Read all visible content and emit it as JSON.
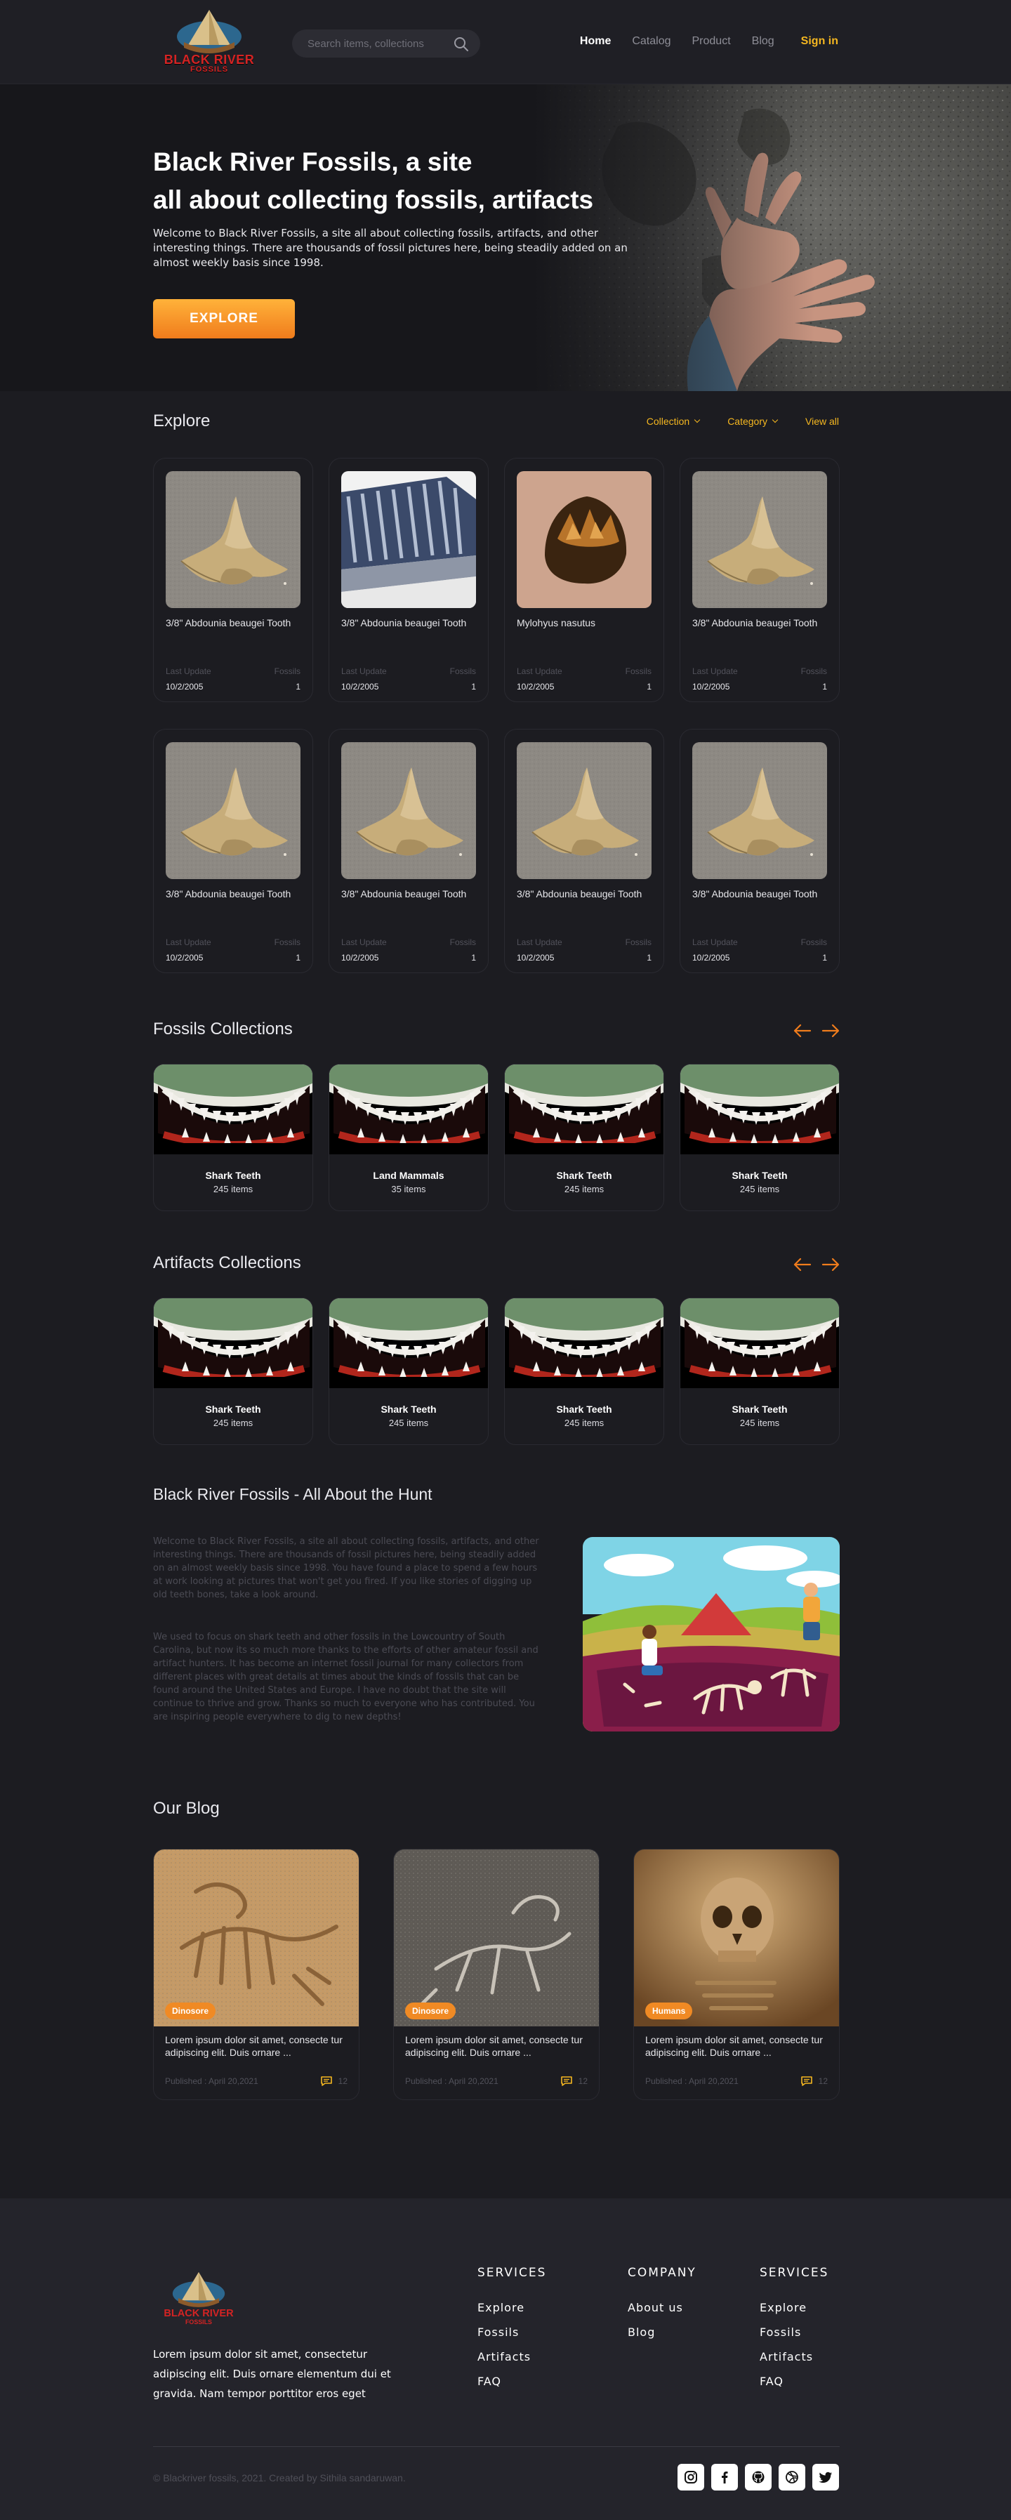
{
  "header": {
    "logo_line1": "BLACK RIVER",
    "logo_line2": "FOSSILS",
    "search_placeholder": "Search items, collections",
    "nav": [
      "Home",
      "Catalog",
      "Product",
      "Blog"
    ],
    "sign_in": "Sign in"
  },
  "hero": {
    "title_line1": "Black River Fossils, a site",
    "title_line2": "all about collecting fossils, artifacts",
    "subtitle": "Welcome to Black River Fossils, a site all about collecting fossils, artifacts, and other interesting things. There are thousands of fossil pictures here, being steadily added on an almost weekly basis since 1998.",
    "cta": "EXPLORE"
  },
  "explore": {
    "title": "Explore",
    "filters": {
      "collection": "Collection",
      "category": "Category",
      "view_all": "View all"
    },
    "last_update_label": "Last Update",
    "fossils_label": "Fossils",
    "items": [
      {
        "name": "3/8\" Abdounia beaugei Tooth",
        "date": "10/2/2005",
        "count": "1",
        "image": "shark-tooth"
      },
      {
        "name": "3/8\" Abdounia beaugei Tooth",
        "date": "10/2/2005",
        "count": "1",
        "image": "mammoth-tooth"
      },
      {
        "name": "Mylohyus nasutus",
        "date": "10/2/2005",
        "count": "1",
        "image": "peccary-tooth"
      },
      {
        "name": "3/8\" Abdounia beaugei Tooth",
        "date": "10/2/2005",
        "count": "1",
        "image": "shark-tooth"
      },
      {
        "name": "3/8\" Abdounia beaugei Tooth",
        "date": "10/2/2005",
        "count": "1",
        "image": "shark-tooth"
      },
      {
        "name": "3/8\" Abdounia beaugei Tooth",
        "date": "10/2/2005",
        "count": "1",
        "image": "shark-tooth"
      },
      {
        "name": "3/8\" Abdounia beaugei Tooth",
        "date": "10/2/2005",
        "count": "1",
        "image": "shark-tooth"
      },
      {
        "name": "3/8\" Abdounia beaugei Tooth",
        "date": "10/2/2005",
        "count": "1",
        "image": "shark-tooth"
      }
    ]
  },
  "fossils_collections": {
    "title": "Fossils Collections",
    "items": [
      {
        "name": "Shark Teeth",
        "count": "245 items"
      },
      {
        "name": "Land Mammals",
        "count": "35 items"
      },
      {
        "name": "Shark Teeth",
        "count": "245 items"
      },
      {
        "name": "Shark Teeth",
        "count": "245 items"
      }
    ]
  },
  "artifacts_collections": {
    "title": "Artifacts Collections",
    "items": [
      {
        "name": "Shark Teeth",
        "count": "245 items"
      },
      {
        "name": "Shark Teeth",
        "count": "245 items"
      },
      {
        "name": "Shark Teeth",
        "count": "245 items"
      },
      {
        "name": "Shark Teeth",
        "count": "245 items"
      }
    ]
  },
  "about": {
    "title": "Black River Fossils - All About the Hunt",
    "p1": "Welcome to Black River Fossils, a site all about collecting fossils, artifacts, and other interesting things. There are thousands of fossil pictures here, being steadily added on an almost weekly basis since 1998. You have found a place to spend a few hours at work looking at pictures that won't get you fired. If you like stories of digging up old teeth bones, take a look around.",
    "p2": "We used to focus on shark teeth and other fossils in the Lowcountry of South Carolina, but now its so much more thanks to the efforts of other amateur fossil and artifact hunters. It has become an internet fossil journal for many collectors from different places with great details at times about the kinds of fossils that can be found around the United States and Europe. I have no doubt that the site will continue to thrive and grow. Thanks so much to everyone who has contributed. You are inspiring people everywhere to dig to new depths!"
  },
  "blog": {
    "title": "Our Blog",
    "posts": [
      {
        "tag": "Dinosore",
        "title": "Lorem ipsum dolor sit amet, consecte tur adipiscing elit. Duis ornare ...",
        "published": "Published : April 20,2021",
        "comments": "12"
      },
      {
        "tag": "Dinosore",
        "title": "Lorem ipsum dolor sit amet, consecte tur adipiscing elit. Duis ornare ...",
        "published": "Published : April 20,2021",
        "comments": "12"
      },
      {
        "tag": "Humans",
        "title": "Lorem ipsum dolor sit amet, consecte tur adipiscing elit. Duis ornare ...",
        "published": "Published : April 20,2021",
        "comments": "12"
      }
    ]
  },
  "footer": {
    "description": "Lorem ipsum dolor sit amet, consectetur adipiscing elit. Duis ornare elementum dui et gravida. Nam tempor porttitor eros eget",
    "columns": [
      {
        "title": "SERVICES",
        "links": [
          "Explore",
          "Fossils",
          "Artifacts",
          "FAQ"
        ]
      },
      {
        "title": "COMPANY",
        "links": [
          "About us",
          "Blog"
        ]
      },
      {
        "title": "SERVICES",
        "links": [
          "Explore",
          "Fossils",
          "Artifacts",
          "FAQ"
        ]
      }
    ],
    "copyright": "© Blackriver fossils, 2021. Created by Sithila sandaruwan.",
    "socials": [
      "instagram-icon",
      "facebook-icon",
      "github-icon",
      "dribbble-icon",
      "twitter-icon"
    ]
  },
  "colors": {
    "accent": "#f5b720",
    "cta": "#f07c1c",
    "background": "#1c1c21",
    "footer": "#24242b"
  }
}
